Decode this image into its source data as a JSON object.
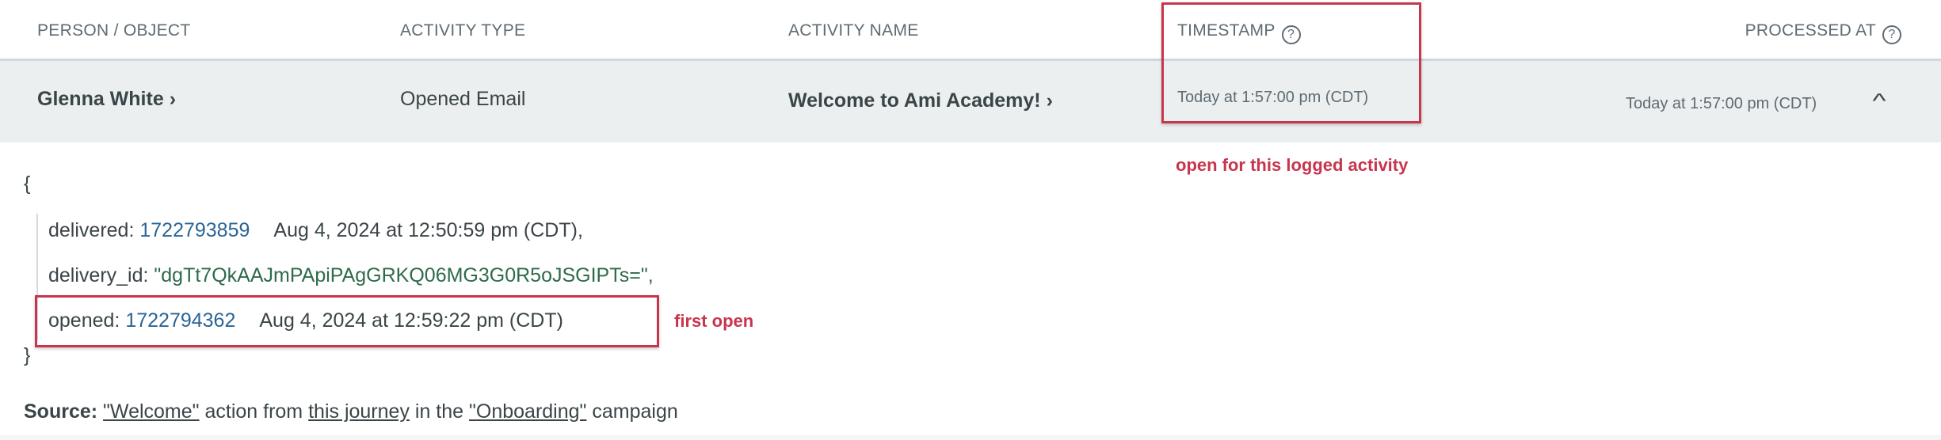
{
  "header": {
    "person": "PERSON / OBJECT",
    "activity_type": "ACTIVITY TYPE",
    "activity_name": "ACTIVITY NAME",
    "timestamp": "TIMESTAMP",
    "processed_at": "PROCESSED AT",
    "help_glyph": "?"
  },
  "row": {
    "person": "Glenna White",
    "activity_type": "Opened Email",
    "activity_name": "Welcome to Ami Academy!",
    "timestamp": "Today at 1:57:00 pm (CDT)",
    "processed_at": "Today at 1:57:00 pm (CDT)",
    "chevron": "›",
    "collapse": "^"
  },
  "details": {
    "open_brace": "{",
    "close_brace": "}",
    "delivered": {
      "key": "delivered:",
      "value": "1722793859",
      "date": "Aug 4, 2024 at 12:50:59 pm (CDT),"
    },
    "delivery_id": {
      "key": "delivery_id:",
      "value": "\"dgTt7QkAAJmPApiPAgGRKQ06MG3G0R5oJSGIPTs=\","
    },
    "opened": {
      "key": "opened:",
      "value": "1722794362",
      "date": "Aug 4, 2024 at 12:59:22 pm (CDT)"
    }
  },
  "source": {
    "label": "Source:",
    "action": "\"Welcome\"",
    "t1": " action from ",
    "journey": "this journey",
    "t2": " in the ",
    "campaign": "\"Onboarding\"",
    "t3": " campaign"
  },
  "annotations": {
    "timestamp_note": "open for this logged activity",
    "opened_note": "first open"
  },
  "colors": {
    "accent_red": "#c8354d",
    "number_blue": "#2a6496",
    "string_green": "#2e6b4a"
  }
}
